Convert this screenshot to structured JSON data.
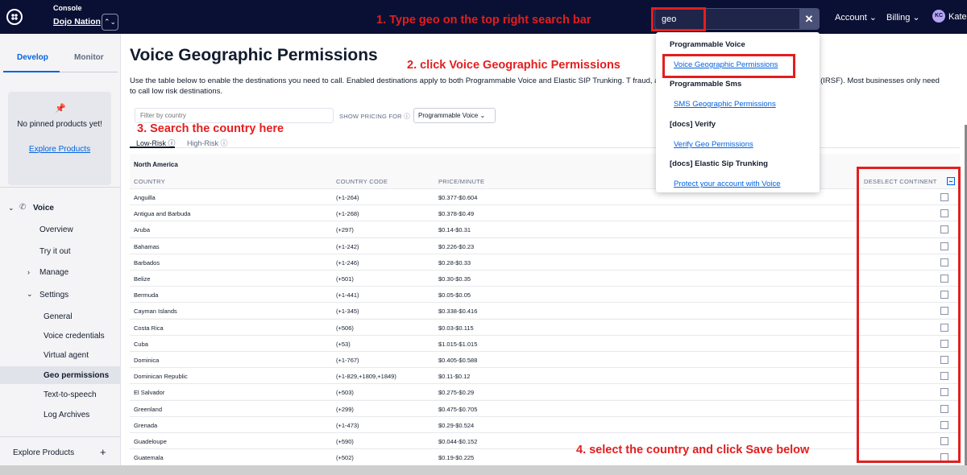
{
  "topbar": {
    "account_small_label": "Console",
    "account_name": "Dojo Nation",
    "switcher_glyph": "⌃⌄",
    "search_value": "geo",
    "clear_glyph": "✕",
    "nav": [
      "Account ⌄",
      "Billing ⌄"
    ],
    "avatar_initials": "KC",
    "user_name": "Kate"
  },
  "sidebar": {
    "tabs": [
      "Develop",
      "Monitor"
    ],
    "pinned_text": "No pinned products yet!",
    "explore_link": "Explore Products",
    "pin_icon": "📌",
    "section": "Voice",
    "items": [
      "Overview",
      "Try it out",
      "Manage",
      "Settings"
    ],
    "settings_items": [
      "General",
      "Voice credentials",
      "Virtual agent",
      "Geo permissions",
      "Text-to-speech",
      "Log Archives"
    ],
    "footer": "Explore Products",
    "footer_plus": "+"
  },
  "main": {
    "title": "Voice Geographic Permissions",
    "description": "Use the table below to enable the destinations you need to call. Enabled destinations apply to both Programmable Voice and Elastic SIP Trunking. T                                                                                                                                    fraud, also called International Revenue Sharing Fraud (IRSF). Most businesses only need to call low risk destinations.",
    "filter_placeholder": "Filter by country",
    "pricing_label": "SHOW PRICING FOR ⓘ",
    "pricing_value": "Programmable Voice ⌄",
    "risk_tabs": [
      "Low-Risk ⓘ",
      "High-Risk ⓘ"
    ],
    "continent": "North America",
    "columns": [
      "COUNTRY",
      "COUNTRY CODE",
      "PRICE/MINUTE",
      "DESELECT CONTINENT"
    ],
    "rows": [
      [
        "Anguilla",
        "(+1-264)",
        "$0.377-$0.604"
      ],
      [
        "Antigua and Barbuda",
        "(+1-268)",
        "$0.378-$0.49"
      ],
      [
        "Aruba",
        "(+297)",
        "$0.14-$0.31"
      ],
      [
        "Bahamas",
        "(+1-242)",
        "$0.226-$0.23"
      ],
      [
        "Barbados",
        "(+1-246)",
        "$0.28-$0.33"
      ],
      [
        "Belize",
        "(+501)",
        "$0.30-$0.35"
      ],
      [
        "Bermuda",
        "(+1-441)",
        "$0.05-$0.05"
      ],
      [
        "Cayman Islands",
        "(+1-345)",
        "$0.338-$0.416"
      ],
      [
        "Costa Rica",
        "(+506)",
        "$0.03-$0.115"
      ],
      [
        "Cuba",
        "(+53)",
        "$1.015-$1.015"
      ],
      [
        "Dominica",
        "(+1-767)",
        "$0.405-$0.588"
      ],
      [
        "Dominican Republic",
        "(+1-829,+1809,+1849)",
        "$0.11-$0.12"
      ],
      [
        "El Salvador",
        "(+503)",
        "$0.275-$0.29"
      ],
      [
        "Greenland",
        "(+299)",
        "$0.475-$0.705"
      ],
      [
        "Grenada",
        "(+1-473)",
        "$0.29-$0.524"
      ],
      [
        "Guadeloupe",
        "(+590)",
        "$0.044-$0.152"
      ],
      [
        "Guatemala",
        "(+502)",
        "$0.19-$0.225"
      ]
    ]
  },
  "dropdown": {
    "groups": [
      {
        "heading": "Programmable Voice",
        "link": "Voice Geographic Permissions"
      },
      {
        "heading": "Programmable Sms",
        "link": "SMS Geographic Permissions"
      },
      {
        "heading": "[docs] Verify",
        "link": "Verify Geo Permissions"
      },
      {
        "heading": "[docs] Elastic Sip Trunking",
        "link": "Protect your account with Voice"
      }
    ]
  },
  "annotations": {
    "step1": "1. Type geo on the top right search bar",
    "step2": "2. click Voice Geographic Permissions",
    "step3": "3. Search the country here",
    "step4": "4. select the country and click Save below"
  },
  "colors": {
    "annotation_red": "#e41e1e",
    "topbar_navy": "#0a1034",
    "link_blue": "#0263e0"
  }
}
